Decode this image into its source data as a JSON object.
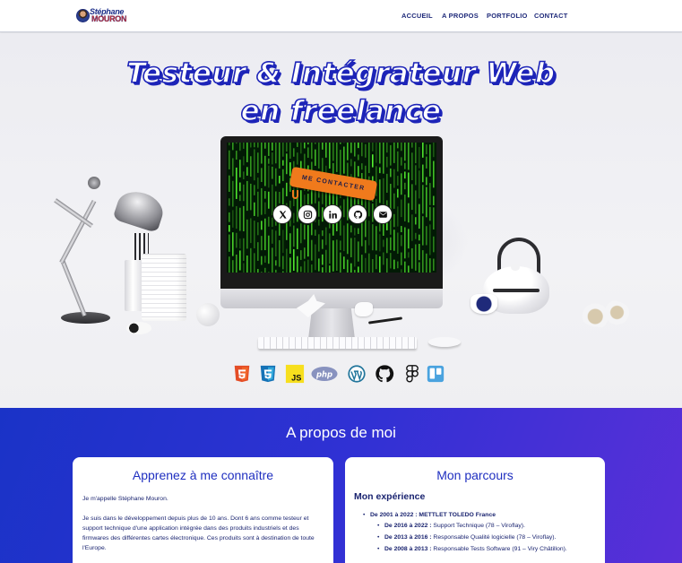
{
  "header": {
    "logo_line1": "Stéphane",
    "logo_line2": "MOURON",
    "nav": [
      "ACCUEIL",
      "A PROPOS",
      "PORTFOLIO",
      "CONTACT"
    ]
  },
  "hero": {
    "title_line1": "Testeur & Intégrateur Web",
    "title_line2": "en freelance",
    "cta_label": "ME CONTACTER",
    "social_icons": [
      "x-icon",
      "instagram-icon",
      "linkedin-icon",
      "github-icon",
      "email-icon"
    ],
    "tech_icons": [
      "html5-icon",
      "css3-icon",
      "javascript-icon",
      "php-icon",
      "wordpress-icon",
      "github-icon",
      "figma-icon",
      "trello-icon"
    ],
    "tech_labels": {
      "js": "JS",
      "php": "php"
    }
  },
  "about": {
    "title": "A propos de moi",
    "left_card": {
      "title": "Apprenez à me connaître",
      "p1": "Je m'appelle Stéphane Mouron.",
      "p2": "Je suis dans le développement depuis plus de 10 ans. Dont 6 ans comme testeur et support technique d'une application intégrée dans des produits industriels et des firmwares des différentes cartes électronique. Ces produits sont à destination de toute l'Europe."
    },
    "right_card": {
      "title": "Mon parcours",
      "subtitle": "Mon expérience",
      "items": [
        {
          "date": "De 2001 à 2022 :",
          "text": "METTLET TOLEDO France"
        },
        {
          "date": "De 2016 à 2022 :",
          "text": "Support Technique (78 – Viroflay)."
        },
        {
          "date": "De 2013 à 2016 :",
          "text": "Responsable Qualité logicielle (78 – Viroflay)."
        },
        {
          "date": "De 2008 à 2013 :",
          "text": "Responsable Tests Software (91 – Viry Châtillon)."
        }
      ]
    }
  },
  "colors": {
    "brand_blue": "#1d24b8",
    "cta_orange": "#f07a1c",
    "about_gradient_start": "#1a33c7",
    "about_gradient_end": "#5a2fd8"
  }
}
